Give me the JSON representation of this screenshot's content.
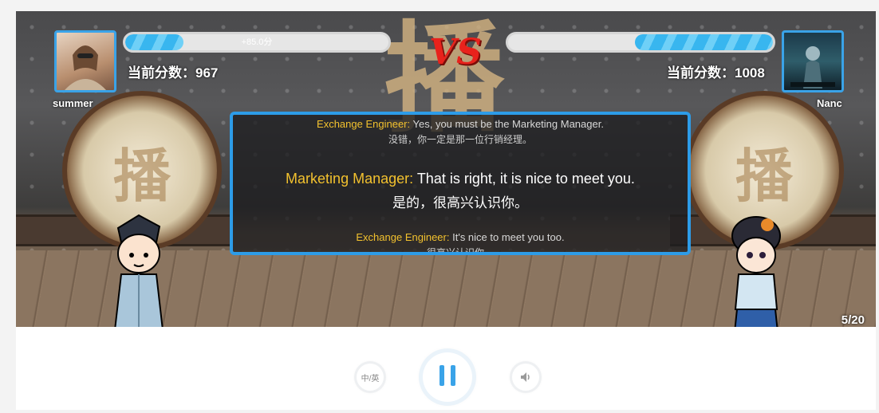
{
  "player_left": {
    "name": "summer",
    "score_label": "当前分数：967",
    "gain_label": "+85.0分",
    "progress": 0.22
  },
  "player_right": {
    "name": "Nanc",
    "score_label": "当前分数：1008",
    "progress": 0.52
  },
  "vs_label": "VS",
  "background_char": "播",
  "dialog": {
    "prev": {
      "speaker": "Exchange Engineer:",
      "en": "Yes, you must be the Marketing Manager.",
      "cn": "没错，你一定是那一位行销经理。"
    },
    "current": {
      "speaker": "Marketing Manager:",
      "en": "That is right, it is nice to meet you.",
      "cn": "是的，很高兴认识你。"
    },
    "next": {
      "speaker": "Exchange Engineer:",
      "en": "It's nice to meet you too.",
      "cn": "很高兴认识你。"
    }
  },
  "page_indicator": "5/20",
  "controls": {
    "lang_toggle": "中/英",
    "pause_icon": "pause-icon",
    "volume_icon": "volume-icon"
  },
  "colors": {
    "accent": "#3aa3e8",
    "speaker": "#f2c12e",
    "vs": "#e8221c"
  }
}
